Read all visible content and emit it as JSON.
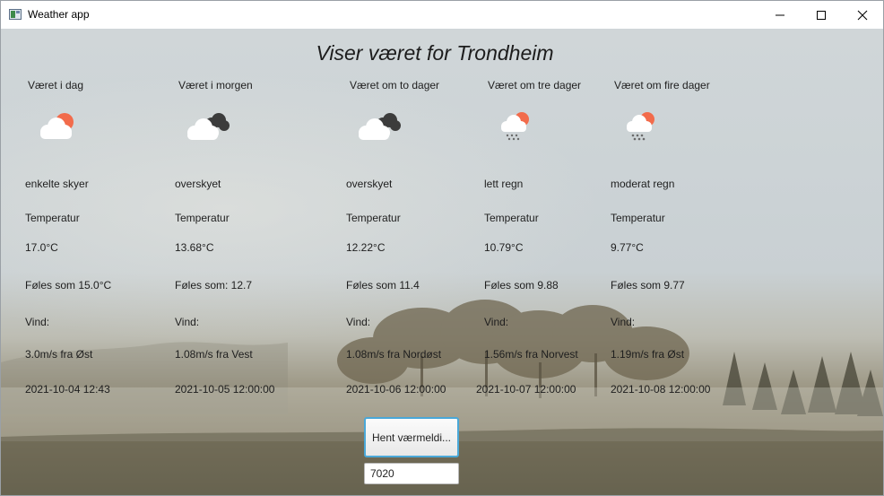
{
  "window": {
    "title": "Weather app",
    "icon": "app-window-icon"
  },
  "heading": "Viser været for Trondheim",
  "labels": {
    "temperature": "Temperatur",
    "wind": "Vind:"
  },
  "forecast": [
    {
      "day_title": "Været i dag",
      "icon": "partly-cloudy-sun-icon",
      "description": "enkelte skyer",
      "temperature": "17.0°C",
      "feels_like": "Føles som 15.0°C",
      "wind": "3.0m/s fra Øst",
      "timestamp": "2021-10-04 12:43"
    },
    {
      "day_title": "Været i morgen",
      "icon": "overcast-clouds-icon",
      "description": "overskyet",
      "temperature": "13.68°C",
      "feels_like": "Føles som: 12.7",
      "wind": "1.08m/s fra Vest",
      "timestamp": "2021-10-05 12:00:00"
    },
    {
      "day_title": "Været om to dager",
      "icon": "overcast-clouds-icon",
      "description": "overskyet",
      "temperature": "12.22°C",
      "feels_like": "Føles som 11.4",
      "wind": "1.08m/s fra Nordøst",
      "timestamp": "2021-10-06 12:00:00"
    },
    {
      "day_title": "Været om tre dager",
      "icon": "light-rain-sun-icon",
      "description": "lett regn",
      "temperature": "10.79°C",
      "feels_like": "Føles som 9.88",
      "wind": "1.56m/s fra Norvest",
      "timestamp": "2021-10-07 12:00:00"
    },
    {
      "day_title": "Været om fire dager",
      "icon": "rain-sun-icon",
      "description": "moderat regn",
      "temperature": "9.77°C",
      "feels_like": "Føles som 9.77",
      "wind": "1.19m/s fra Øst",
      "timestamp": "2021-10-08 12:00:00"
    }
  ],
  "controls": {
    "fetch_button_label": "Hent værmeldi...",
    "postcode_value": "7020"
  },
  "colors": {
    "sun": "#f26b4b",
    "cloud": "#ffffff",
    "dark_cloud": "#3c3c3c",
    "rain": "#6a6a6a",
    "button_border": "#4aa8d8"
  }
}
